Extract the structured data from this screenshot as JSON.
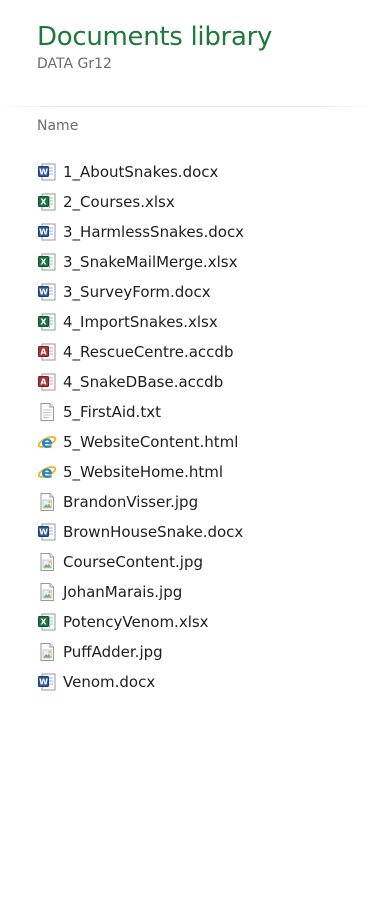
{
  "library": {
    "title": "Documents library",
    "subtitle": "DATA Gr12"
  },
  "columns": {
    "name_label": "Name"
  },
  "files": [
    {
      "name": "1_AboutSnakes.docx",
      "icon": "word-doc-icon"
    },
    {
      "name": "2_Courses.xlsx",
      "icon": "excel-sheet-icon"
    },
    {
      "name": "3_HarmlessSnakes.docx",
      "icon": "word-doc-icon"
    },
    {
      "name": "3_SnakeMailMerge.xlsx",
      "icon": "excel-sheet-icon"
    },
    {
      "name": "3_SurveyForm.docx",
      "icon": "word-doc-icon"
    },
    {
      "name": "4_ImportSnakes.xlsx",
      "icon": "excel-sheet-icon"
    },
    {
      "name": "4_RescueCentre.accdb",
      "icon": "access-db-icon"
    },
    {
      "name": "4_SnakeDBase.accdb",
      "icon": "access-db-icon"
    },
    {
      "name": "5_FirstAid.txt",
      "icon": "text-file-icon"
    },
    {
      "name": "5_WebsiteContent.html",
      "icon": "internet-explorer-icon"
    },
    {
      "name": "5_WebsiteHome.html",
      "icon": "internet-explorer-icon"
    },
    {
      "name": "BrandonVisser.jpg",
      "icon": "image-file-icon"
    },
    {
      "name": "BrownHouseSnake.docx",
      "icon": "word-doc-icon"
    },
    {
      "name": "CourseContent.jpg",
      "icon": "image-file-icon"
    },
    {
      "name": "JohanMarais.jpg",
      "icon": "image-file-icon"
    },
    {
      "name": "PotencyVenom.xlsx",
      "icon": "excel-sheet-icon"
    },
    {
      "name": "PuffAdder.jpg",
      "icon": "image-file-icon"
    },
    {
      "name": "Venom.docx",
      "icon": "word-doc-icon"
    }
  ],
  "colors": {
    "title_green": "#1f7a3a",
    "word_blue": "#2b5797",
    "excel_green": "#1e7145",
    "access_red": "#a4373a",
    "ie_blue": "#1e88d8",
    "ie_gold": "#f2b21c"
  }
}
